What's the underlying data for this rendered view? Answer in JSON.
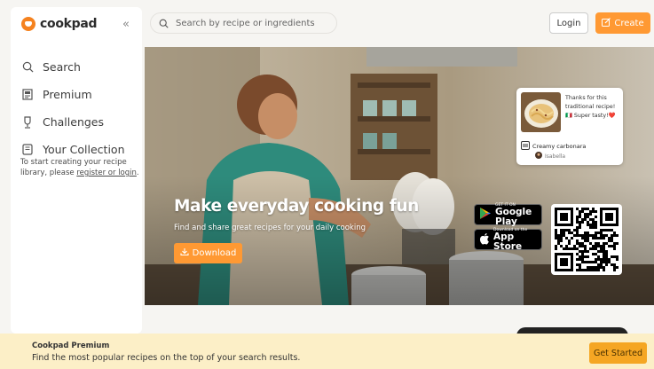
{
  "brand": {
    "name": "cookpad",
    "color": "#f5821f"
  },
  "sidebar": {
    "collapse_icon": "chevrons-left-icon",
    "items": [
      {
        "label": "Search",
        "icon": "search-icon"
      },
      {
        "label": "Premium",
        "icon": "premium-icon"
      },
      {
        "label": "Challenges",
        "icon": "trophy-icon"
      },
      {
        "label": "Your Collection",
        "icon": "collection-icon"
      }
    ],
    "note_prefix": "To start creating your recipe library, please ",
    "note_link": "register or login",
    "note_suffix": "."
  },
  "header": {
    "search_placeholder": "Search by recipe or ingredients",
    "login_label": "Login",
    "create_label": "Create",
    "accent": "#ff9933"
  },
  "hero": {
    "title": "Make everyday cooking fun",
    "subtitle": "Find and share great recipes for your daily cooking",
    "download_label": "Download",
    "google_play_small": "GET IT ON",
    "google_play_big": "Google Play",
    "app_store_small": "Download on the",
    "app_store_big": "App Store"
  },
  "recipe_card": {
    "quote": "Thanks for this traditional recipe! 🇮🇹 Super tasty!❤️",
    "recipe_name": "Creamy carbonara",
    "author": "Isabella"
  },
  "banner": {
    "title": "Cookpad Premium",
    "text": "Find the most popular recipes on the top of your search results.",
    "button_label": "Get Started",
    "background": "#fcefc7"
  }
}
